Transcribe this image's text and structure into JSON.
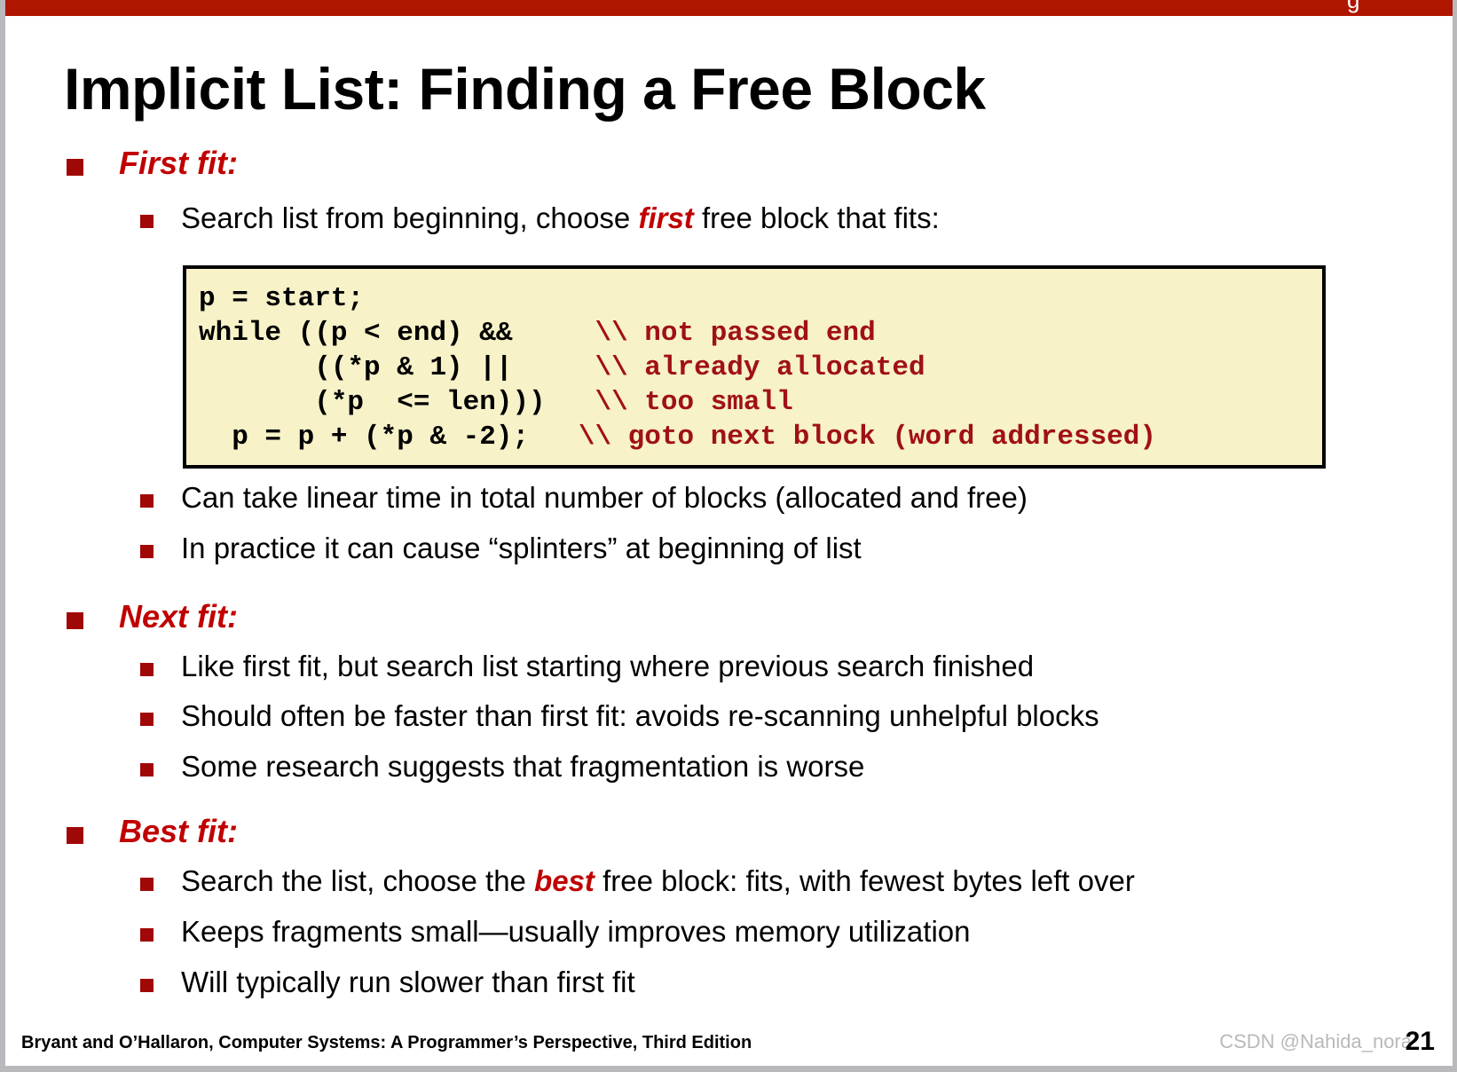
{
  "slide": {
    "title": "Implicit List: Finding a Free Block",
    "header_cutoff_glyph": "g",
    "page_number": "21",
    "footer_credit": "Bryant and O’Hallaron, Computer Systems: A Programmer’s Perspective, Third Edition",
    "watermark": "CSDN @Nahida_nora"
  },
  "colors": {
    "header_bar": "#b01500",
    "heading_red": "#c00000",
    "bullet_square": "#a00808",
    "code_background": "#f7f2c8",
    "code_comment": "#a01018",
    "code_border": "#000000",
    "frame_gray": "#b8b8bd",
    "watermark_gray": "#b9b9b9"
  },
  "sections": {
    "first_fit": {
      "heading": "First fit:",
      "intro_pre": "Search list from beginning, choose ",
      "intro_highlight": "first",
      "intro_post": " free block that fits:",
      "after_code": [
        "Can take linear time in total number of blocks (allocated and free)",
        "In practice it can cause “splinters” at beginning of list"
      ]
    },
    "next_fit": {
      "heading": "Next fit:",
      "items": [
        "Like first fit, but search list starting where previous search finished",
        "Should often be faster than first fit: avoids re-scanning unhelpful blocks",
        "Some research suggests that fragmentation is worse"
      ]
    },
    "best_fit": {
      "heading": "Best fit:",
      "item1_pre": "Search the list, choose the ",
      "item1_highlight": "best",
      "item1_post": " free block: fits, with fewest bytes left over",
      "items": [
        "Keeps fragments small—usually improves memory utilization",
        "Will typically run slower than first fit"
      ]
    }
  },
  "code_block": {
    "lines": [
      {
        "code": "p = start;",
        "comment": ""
      },
      {
        "code": "while ((p < end) &&     ",
        "comment": "\\\\ not passed end"
      },
      {
        "code": "       ((*p & 1) ||     ",
        "comment": "\\\\ already allocated"
      },
      {
        "code": "       (*p  <= len)))   ",
        "comment": "\\\\ too small"
      },
      {
        "code": "  p = p + (*p & -2);   ",
        "comment": "\\\\ goto next block (word addressed)"
      }
    ]
  }
}
